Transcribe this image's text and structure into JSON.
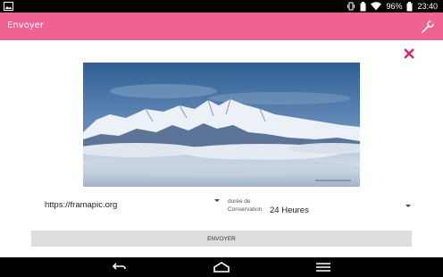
{
  "status_bar": {
    "battery": "96%",
    "time": "23:40",
    "icons": [
      "image-icon",
      "vibrate-icon",
      "battery-icon",
      "wifi-icon",
      "battery-level-icon"
    ]
  },
  "app_bar": {
    "title": "Envoyer",
    "action_icon": "wrench-icon"
  },
  "preview": {
    "close_icon": "close-icon",
    "caption": "Image: mountain range above a sea of clouds"
  },
  "form": {
    "service_value": "https://framapic.org",
    "duration_label": "durée de Conservation",
    "duration_value": "24 Heures",
    "send_label": "ENVOYER"
  },
  "colors": {
    "app_bar": "#f06292",
    "close": "#e91e63",
    "button": "#dddddd"
  },
  "nav_bar": {
    "icons": [
      "back-icon",
      "home-icon",
      "recent-apps-icon"
    ]
  }
}
